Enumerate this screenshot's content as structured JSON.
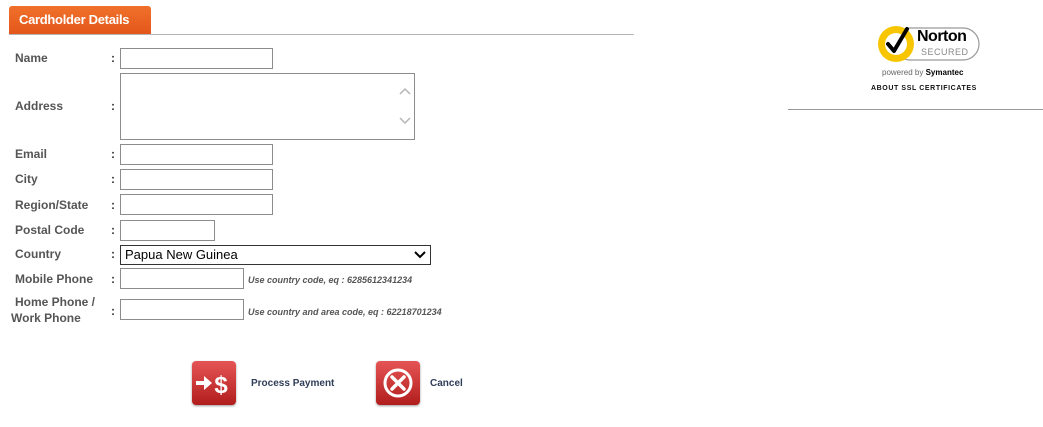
{
  "section": {
    "title": "Cardholder Details"
  },
  "form": {
    "name_label": "Name",
    "address_label": "Address",
    "email_label": "Email",
    "city_label": "City",
    "region_label": "Region/State",
    "postal_label": "Postal Code",
    "country_label": "Country",
    "country_value": "Papua New Guinea",
    "mobile_label": "Mobile Phone",
    "mobile_hint": "Use country code, eq : 6285612341234",
    "home_label_line1": "Home Phone /",
    "home_label_line2": "Work Phone",
    "home_hint": "Use country and area code, eq : 62218701234",
    "separator": ":"
  },
  "actions": {
    "process_label": "Process Payment",
    "cancel_label": "Cancel"
  },
  "norton": {
    "brand": "Norton",
    "secured": "SECURED",
    "powered_prefix": "powered by ",
    "powered_brand": "Symantec",
    "about": "ABOUT SSL CERTIFICATES"
  },
  "colors": {
    "tab": "#e85d20",
    "button_red": "#c62828",
    "norton_yellow": "#f7c600"
  },
  "icons": [
    "arrow-dollar-icon",
    "cancel-x-icon",
    "norton-checkmark-icon",
    "chevron-down-icon"
  ]
}
